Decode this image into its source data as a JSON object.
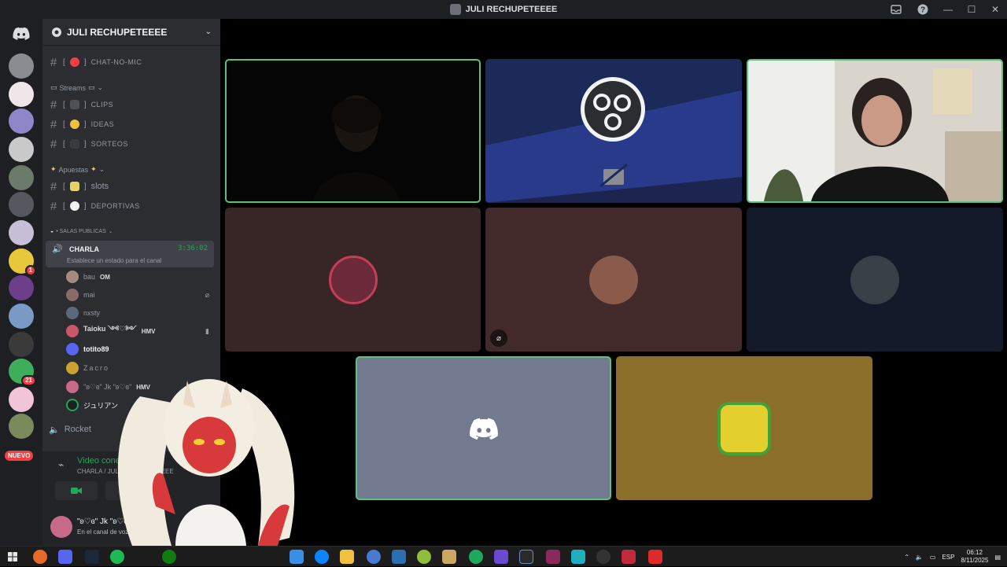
{
  "window": {
    "title": "JULI RECHUPETEEEE"
  },
  "servers": {
    "nuevo_label": "NUEVO",
    "badges": [
      "1",
      "21"
    ]
  },
  "guild": {
    "name": "JULI RECHUPETEEEE"
  },
  "channels": {
    "top": [
      {
        "bracket": "[",
        "bracket_end": "]",
        "label": "chat-no-mic"
      }
    ],
    "categories": [
      {
        "label": "Streams",
        "items": [
          {
            "label": "clips"
          },
          {
            "label": "ideas"
          },
          {
            "label": "sorteos"
          }
        ]
      },
      {
        "label": "Apuestas",
        "items": [
          {
            "label": "slots"
          },
          {
            "label": "deportivas"
          }
        ]
      },
      {
        "label": "• SALAS PUBLICAS"
      }
    ]
  },
  "voice_channel": {
    "name": "CHARLA",
    "timer": "3:36:02",
    "status": "Establece un estado para el canal",
    "members": [
      {
        "name": "bau",
        "tag": "OM"
      },
      {
        "name": "mai",
        "tag": ""
      },
      {
        "name": "nxsty",
        "tag": ""
      },
      {
        "name": "Taioku ༺♡༻",
        "tag": "HMV"
      },
      {
        "name": "totito89",
        "tag": ""
      },
      {
        "name": "Zacro",
        "tag": ""
      },
      {
        "name": "\"ʚ♡ɞ\" Jk \"ʚ♡ɞ\"",
        "tag": "HMV"
      },
      {
        "name": "ジュリアン",
        "tag": ""
      }
    ]
  },
  "next_channel": {
    "label": "Rocket"
  },
  "voice_panel": {
    "status": "Video conectado",
    "sub": "CHARLA / JULI RECHUPETEEEE"
  },
  "user": {
    "name": "\"ʚ♡ɞ\" Jk \"ʚ♡ɞ\"",
    "sub": "En el canal de voz"
  },
  "colors": {
    "accent_green": "#23a55a",
    "speaking_border": "#5ac27a",
    "danger": "#f23f43",
    "blurple": "#5865f2"
  },
  "taskbar": {
    "lang": "ESP",
    "time": "06:12",
    "date": "8/11/2025"
  }
}
